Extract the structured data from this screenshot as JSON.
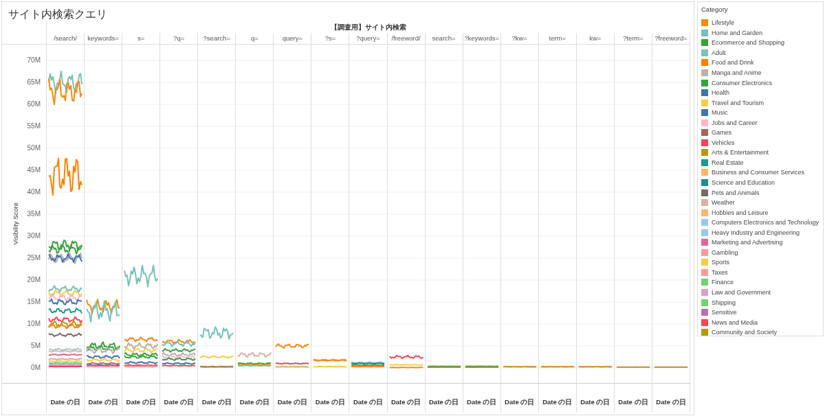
{
  "title": "サイト内検索クエリ",
  "chart": {
    "header": "【調査用】サイト内検索",
    "columns": [
      "/search/",
      "keywords=",
      "s=",
      "?q=",
      "?search=",
      "q=",
      "query=",
      "?s=",
      "?query=",
      "/freeword/",
      "search=",
      "?keywords=",
      "?kw=",
      "term=",
      "kw=",
      "?term=",
      "?freeword="
    ],
    "y_axis": {
      "title": "Visibility Score",
      "ticks": [
        "70M",
        "65M",
        "60M",
        "55M",
        "50M",
        "45M",
        "40M",
        "35M",
        "30M",
        "25M",
        "20M",
        "15M",
        "10M",
        "5M",
        "0M"
      ]
    },
    "x_labels": [
      "Date の日",
      "Date の日",
      "Date の日",
      "Date の日",
      "Date の日",
      "Date の日",
      "Date の日",
      "Date の日",
      "Date の日",
      "Date の日",
      "Date の日",
      "Date の日",
      "Date の日",
      "Date の日",
      "Date の日",
      "Date の日",
      "Date の日"
    ]
  },
  "legend": {
    "title": "Category",
    "items": [
      {
        "label": "Lifestyle",
        "color": "#f98a0c"
      },
      {
        "label": "Home and Garden",
        "color": "#76c1b9"
      },
      {
        "label": "Ecommerce and Shopping",
        "color": "#3ba03b"
      },
      {
        "label": "Adult",
        "color": "#7dc3bb"
      },
      {
        "label": "Food and Drink",
        "color": "#ff8000"
      },
      {
        "label": "Manga and Anime",
        "color": "#bab0ac"
      },
      {
        "label": "Consumer Electronics",
        "color": "#39a33f"
      },
      {
        "label": "Health",
        "color": "#3f76ad"
      },
      {
        "label": "Travel and Tourism",
        "color": "#f9cd45"
      },
      {
        "label": "Music",
        "color": "#4477aa"
      },
      {
        "label": "Jobs and Career",
        "color": "#fcb6cf"
      },
      {
        "label": "Games",
        "color": "#9e6b56"
      },
      {
        "label": "Vehicles",
        "color": "#f2475a"
      },
      {
        "label": "Arts & Entertainment",
        "color": "#b89a0a"
      },
      {
        "label": "Real Estate",
        "color": "#1d9a8e"
      },
      {
        "label": "Business and Consumer Services",
        "color": "#ffb56b"
      },
      {
        "label": "Science and Education",
        "color": "#1a9189"
      },
      {
        "label": "Pets and Animals",
        "color": "#7a6a66"
      },
      {
        "label": "Weather",
        "color": "#dcb2a0"
      },
      {
        "label": "Hobbies and Leisure",
        "color": "#ffb66a"
      },
      {
        "label": "Computers Electronics and Technology",
        "color": "#98cae8"
      },
      {
        "label": "Heavy Industry and Engineering",
        "color": "#96cbe9"
      },
      {
        "label": "Marketing and Advertising",
        "color": "#e0679a"
      },
      {
        "label": "Gambling",
        "color": "#fc9a9c"
      },
      {
        "label": "Sports",
        "color": "#f7cd44"
      },
      {
        "label": "Taxes",
        "color": "#fd9a9d"
      },
      {
        "label": "Finance",
        "color": "#73d073"
      },
      {
        "label": "Law and Government",
        "color": "#d7a1c9"
      },
      {
        "label": "Shipping",
        "color": "#72d46f"
      },
      {
        "label": "Sensitive",
        "color": "#b573a8"
      },
      {
        "label": "News and Media",
        "color": "#f34755"
      },
      {
        "label": "Community and Society",
        "color": "#b59a0b"
      }
    ]
  }
}
